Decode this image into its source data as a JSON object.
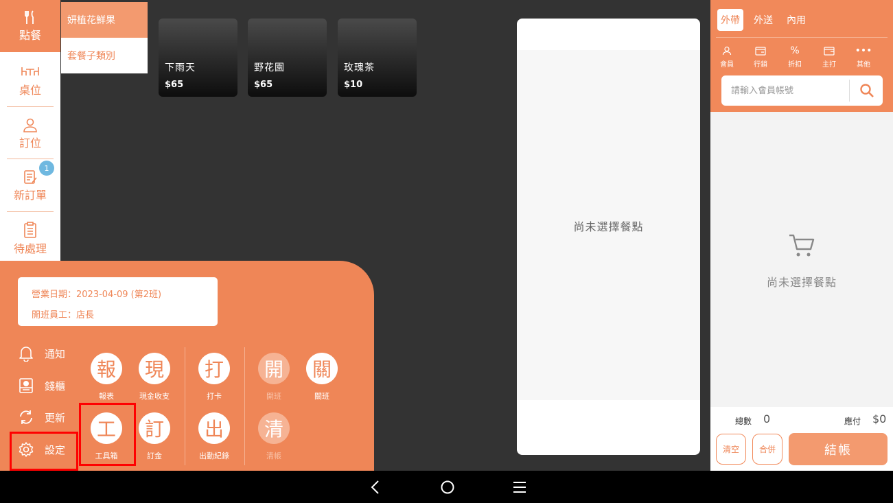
{
  "nav": {
    "items": [
      {
        "label": "點餐",
        "icon": "utensils-icon",
        "active": true
      },
      {
        "label": "桌位",
        "icon": "table-icon"
      },
      {
        "label": "訂位",
        "icon": "person-icon"
      },
      {
        "label": "新訂單",
        "icon": "order-list-icon",
        "badge": "1"
      },
      {
        "label": "待處理",
        "icon": "clipboard-icon"
      }
    ]
  },
  "categories": [
    {
      "label": "妍植花鮮果",
      "active": true
    },
    {
      "label": "套餐子類別"
    }
  ],
  "products": [
    {
      "name": "下雨天",
      "price": "$65"
    },
    {
      "name": "野花園",
      "price": "$65"
    },
    {
      "name": "玫瑰茶",
      "price": "$10"
    }
  ],
  "center": {
    "empty_text": "尚未選擇餐點"
  },
  "order": {
    "tabs": [
      "外帶",
      "外送",
      "內用"
    ],
    "actions": [
      {
        "label": "會員",
        "icon": "member-icon"
      },
      {
        "label": "行銷",
        "icon": "card-icon"
      },
      {
        "label": "折扣",
        "icon": "percent-icon"
      },
      {
        "label": "主打",
        "icon": "wallet-icon"
      },
      {
        "label": "其他",
        "icon": "more-icon"
      }
    ],
    "search_placeholder": "請輸入會員帳號",
    "empty_text": "尚未選擇餐點",
    "total_count_label": "總數",
    "total_count_value": "0",
    "payable_label": "應付",
    "payable_value": "$0",
    "clear_label": "清空",
    "merge_label": "合併",
    "checkout_label": "結帳"
  },
  "popup": {
    "business_date": "營業日期：2023-04-09 (第2班)",
    "shift_staff": "開班員工：店長",
    "side_items": [
      {
        "label": "通知",
        "icon": "bell-icon"
      },
      {
        "label": "錢櫃",
        "icon": "cash-drawer-icon"
      },
      {
        "label": "更新",
        "icon": "refresh-icon"
      },
      {
        "label": "設定",
        "icon": "gear-icon"
      }
    ],
    "functions": [
      {
        "glyph": "報",
        "label": "報表"
      },
      {
        "glyph": "現",
        "label": "現金收支"
      },
      {
        "glyph": "打",
        "label": "打卡"
      },
      {
        "glyph": "開",
        "label": "開班",
        "disabled": true
      },
      {
        "glyph": "關",
        "label": "關班"
      },
      {
        "glyph": "工",
        "label": "工具箱"
      },
      {
        "glyph": "訂",
        "label": "訂金"
      },
      {
        "glyph": "出",
        "label": "出勤紀錄"
      },
      {
        "glyph": "清",
        "label": "清帳",
        "disabled": true
      }
    ]
  },
  "colors": {
    "accent": "#F1895A",
    "background": "#333333",
    "highlight": "#FF0000",
    "badge": "#6FB8E0"
  }
}
